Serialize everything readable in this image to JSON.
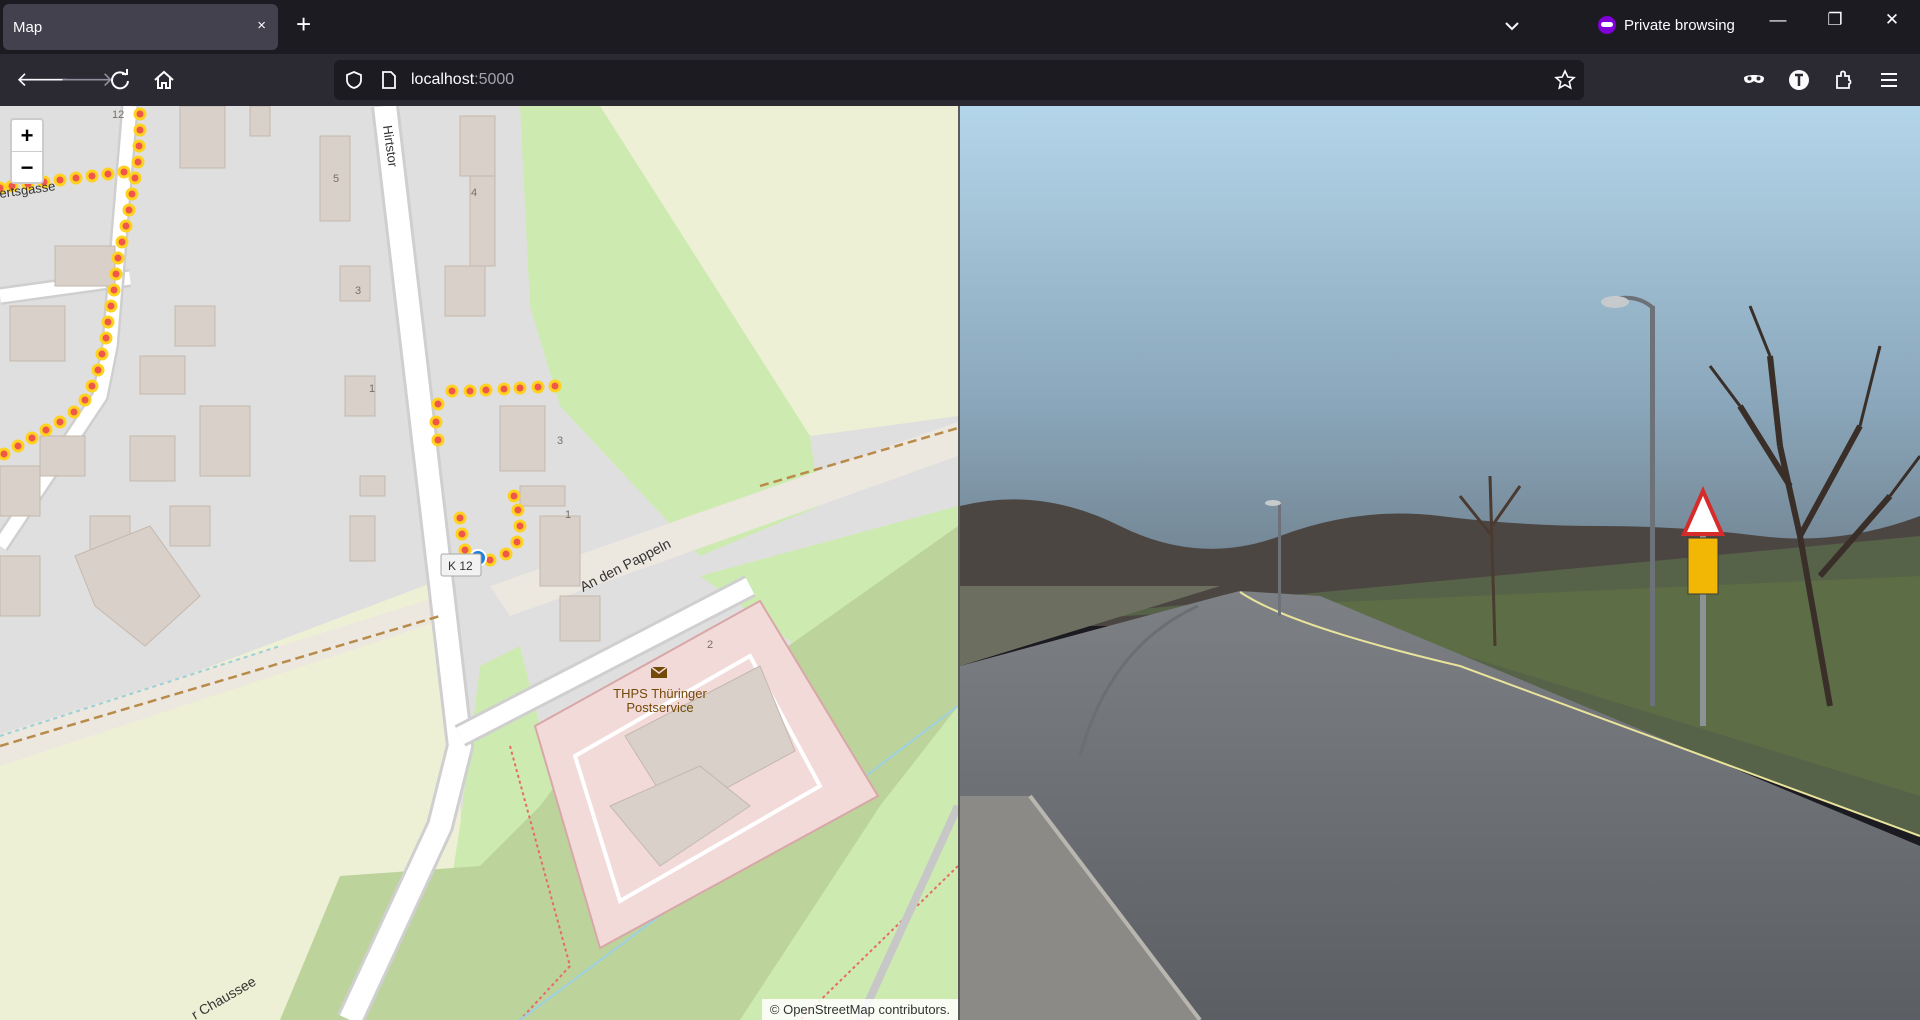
{
  "browser": {
    "tab_title": "Map",
    "tab_close": "×",
    "new_tab": "+",
    "private_label": "Private browsing",
    "url_host": "localhost",
    "url_port": ":5000"
  },
  "map": {
    "zoom_in": "+",
    "zoom_out": "−",
    "attribution": "© OpenStreetMap contributors.",
    "labels": {
      "hirtstor": "Hirtstor",
      "an_den_pappeln": "An den Pappeln",
      "chaussee": "r Chaussee",
      "gasse": "ertsgasse",
      "road_ref": "K 12",
      "poi_name_1": "THPS Thüringer",
      "poi_name_2": "Postservice",
      "h12": "12",
      "h5": "5",
      "h4": "4",
      "h3a": "3",
      "h1a": "1",
      "h3b": "3",
      "h1b": "1",
      "h2": "2"
    }
  },
  "colors": {
    "track_dot": "#f0574a",
    "track_outline": "#ffd21f",
    "position_marker": "#1f7fd8"
  }
}
